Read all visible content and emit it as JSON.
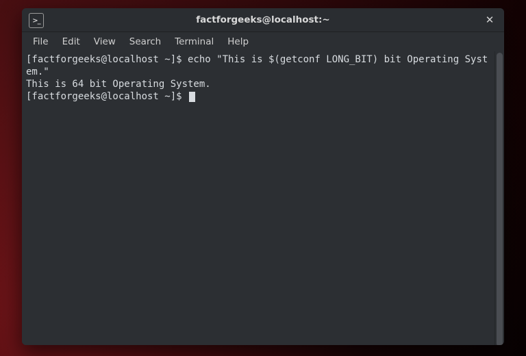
{
  "window": {
    "title": "factforgeeks@localhost:~"
  },
  "menubar": {
    "items": [
      "File",
      "Edit",
      "View",
      "Search",
      "Terminal",
      "Help"
    ]
  },
  "terminal": {
    "lines": [
      {
        "prompt": "[factforgeeks@localhost ~]$ ",
        "cmd": "echo \"This is $(getconf LONG_BIT) bit Operating System.\""
      },
      {
        "text": "This is 64 bit Operating System."
      },
      {
        "prompt": "[factforgeeks@localhost ~]$ ",
        "cmd": "",
        "cursor": true
      }
    ]
  }
}
